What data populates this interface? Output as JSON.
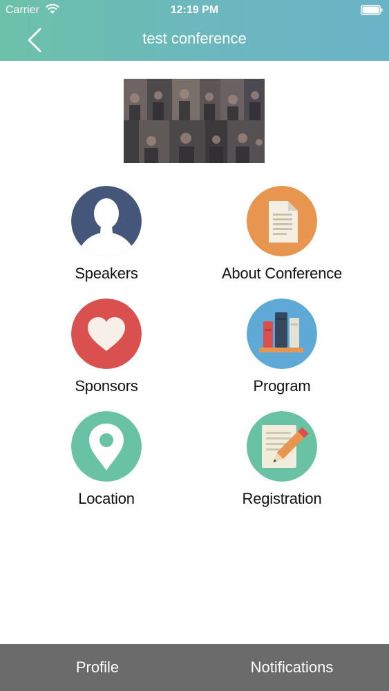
{
  "status_bar": {
    "carrier": "Carrier",
    "time": "12:19 PM"
  },
  "nav": {
    "title": "test conference"
  },
  "menu": [
    {
      "label": "Speakers",
      "icon": "speaker-person-icon",
      "color": "#44577a"
    },
    {
      "label": "About Conference",
      "icon": "document-icon",
      "color": "#e8954f"
    },
    {
      "label": "Sponsors",
      "icon": "heart-icon",
      "color": "#d9504f"
    },
    {
      "label": "Program",
      "icon": "books-icon",
      "color": "#5fa9d6"
    },
    {
      "label": "Location",
      "icon": "map-pin-icon",
      "color": "#69c2a4"
    },
    {
      "label": "Registration",
      "icon": "notepad-pencil-icon",
      "color": "#69c2a4"
    }
  ],
  "tab_bar": {
    "profile": "Profile",
    "notifications": "Notifications"
  },
  "colors": {
    "header_start": "#6cc2a8",
    "header_end": "#6ab4c7",
    "tab_bar_bg": "#6b6b6b"
  }
}
